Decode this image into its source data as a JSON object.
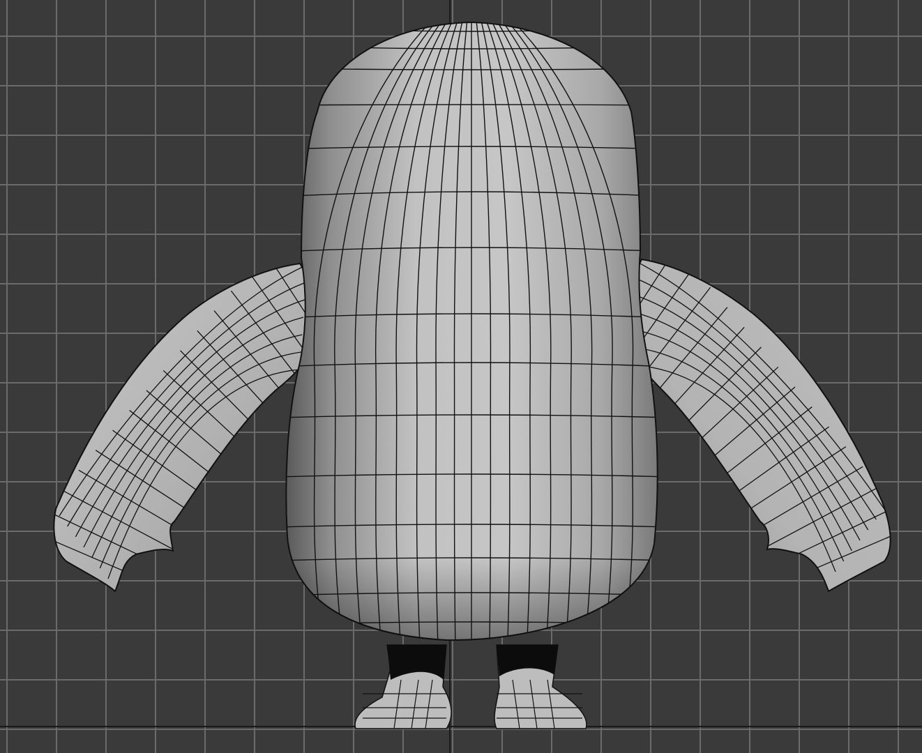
{
  "viewport": {
    "view": "front",
    "shading": "smooth-edged-faces",
    "active_border_color": "#8a7a3a",
    "background_color": "#3a3a3a",
    "grid_color": "#6b6b6b",
    "axis_color": "#1a1a1a"
  },
  "model": {
    "object": "character-mesh",
    "parts": [
      "body",
      "left-arm",
      "right-arm",
      "left-foot",
      "right-foot"
    ],
    "surface_color": "#b8b8b8",
    "wire_color": "#111111"
  }
}
